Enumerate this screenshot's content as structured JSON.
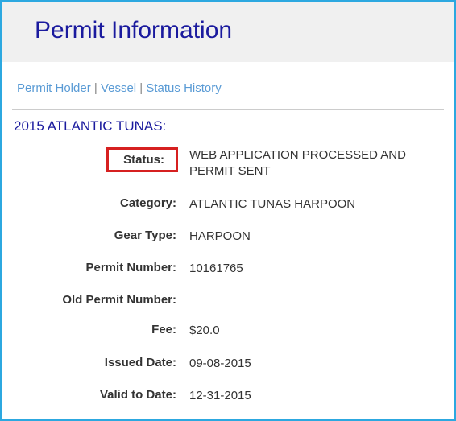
{
  "header": {
    "title": "Permit Information"
  },
  "nav": {
    "permit_holder": "Permit Holder",
    "vessel": "Vessel",
    "status_history": "Status History",
    "sep": " | "
  },
  "section": {
    "title": "2015 ATLANTIC TUNAS:"
  },
  "labels": {
    "status": "Status:",
    "category": "Category:",
    "gear_type": "Gear Type:",
    "permit_number": "Permit Number:",
    "old_permit_number": "Old Permit Number:",
    "fee": "Fee:",
    "issued_date": "Issued Date:",
    "valid_to_date": "Valid to Date:"
  },
  "values": {
    "status": "WEB APPLICATION PROCESSED AND PERMIT SENT",
    "category": "ATLANTIC TUNAS HARPOON",
    "gear_type": "HARPOON",
    "permit_number": "10161765",
    "old_permit_number": "",
    "fee": "$20.0",
    "issued_date": "09-08-2015",
    "valid_to_date": "12-31-2015"
  }
}
